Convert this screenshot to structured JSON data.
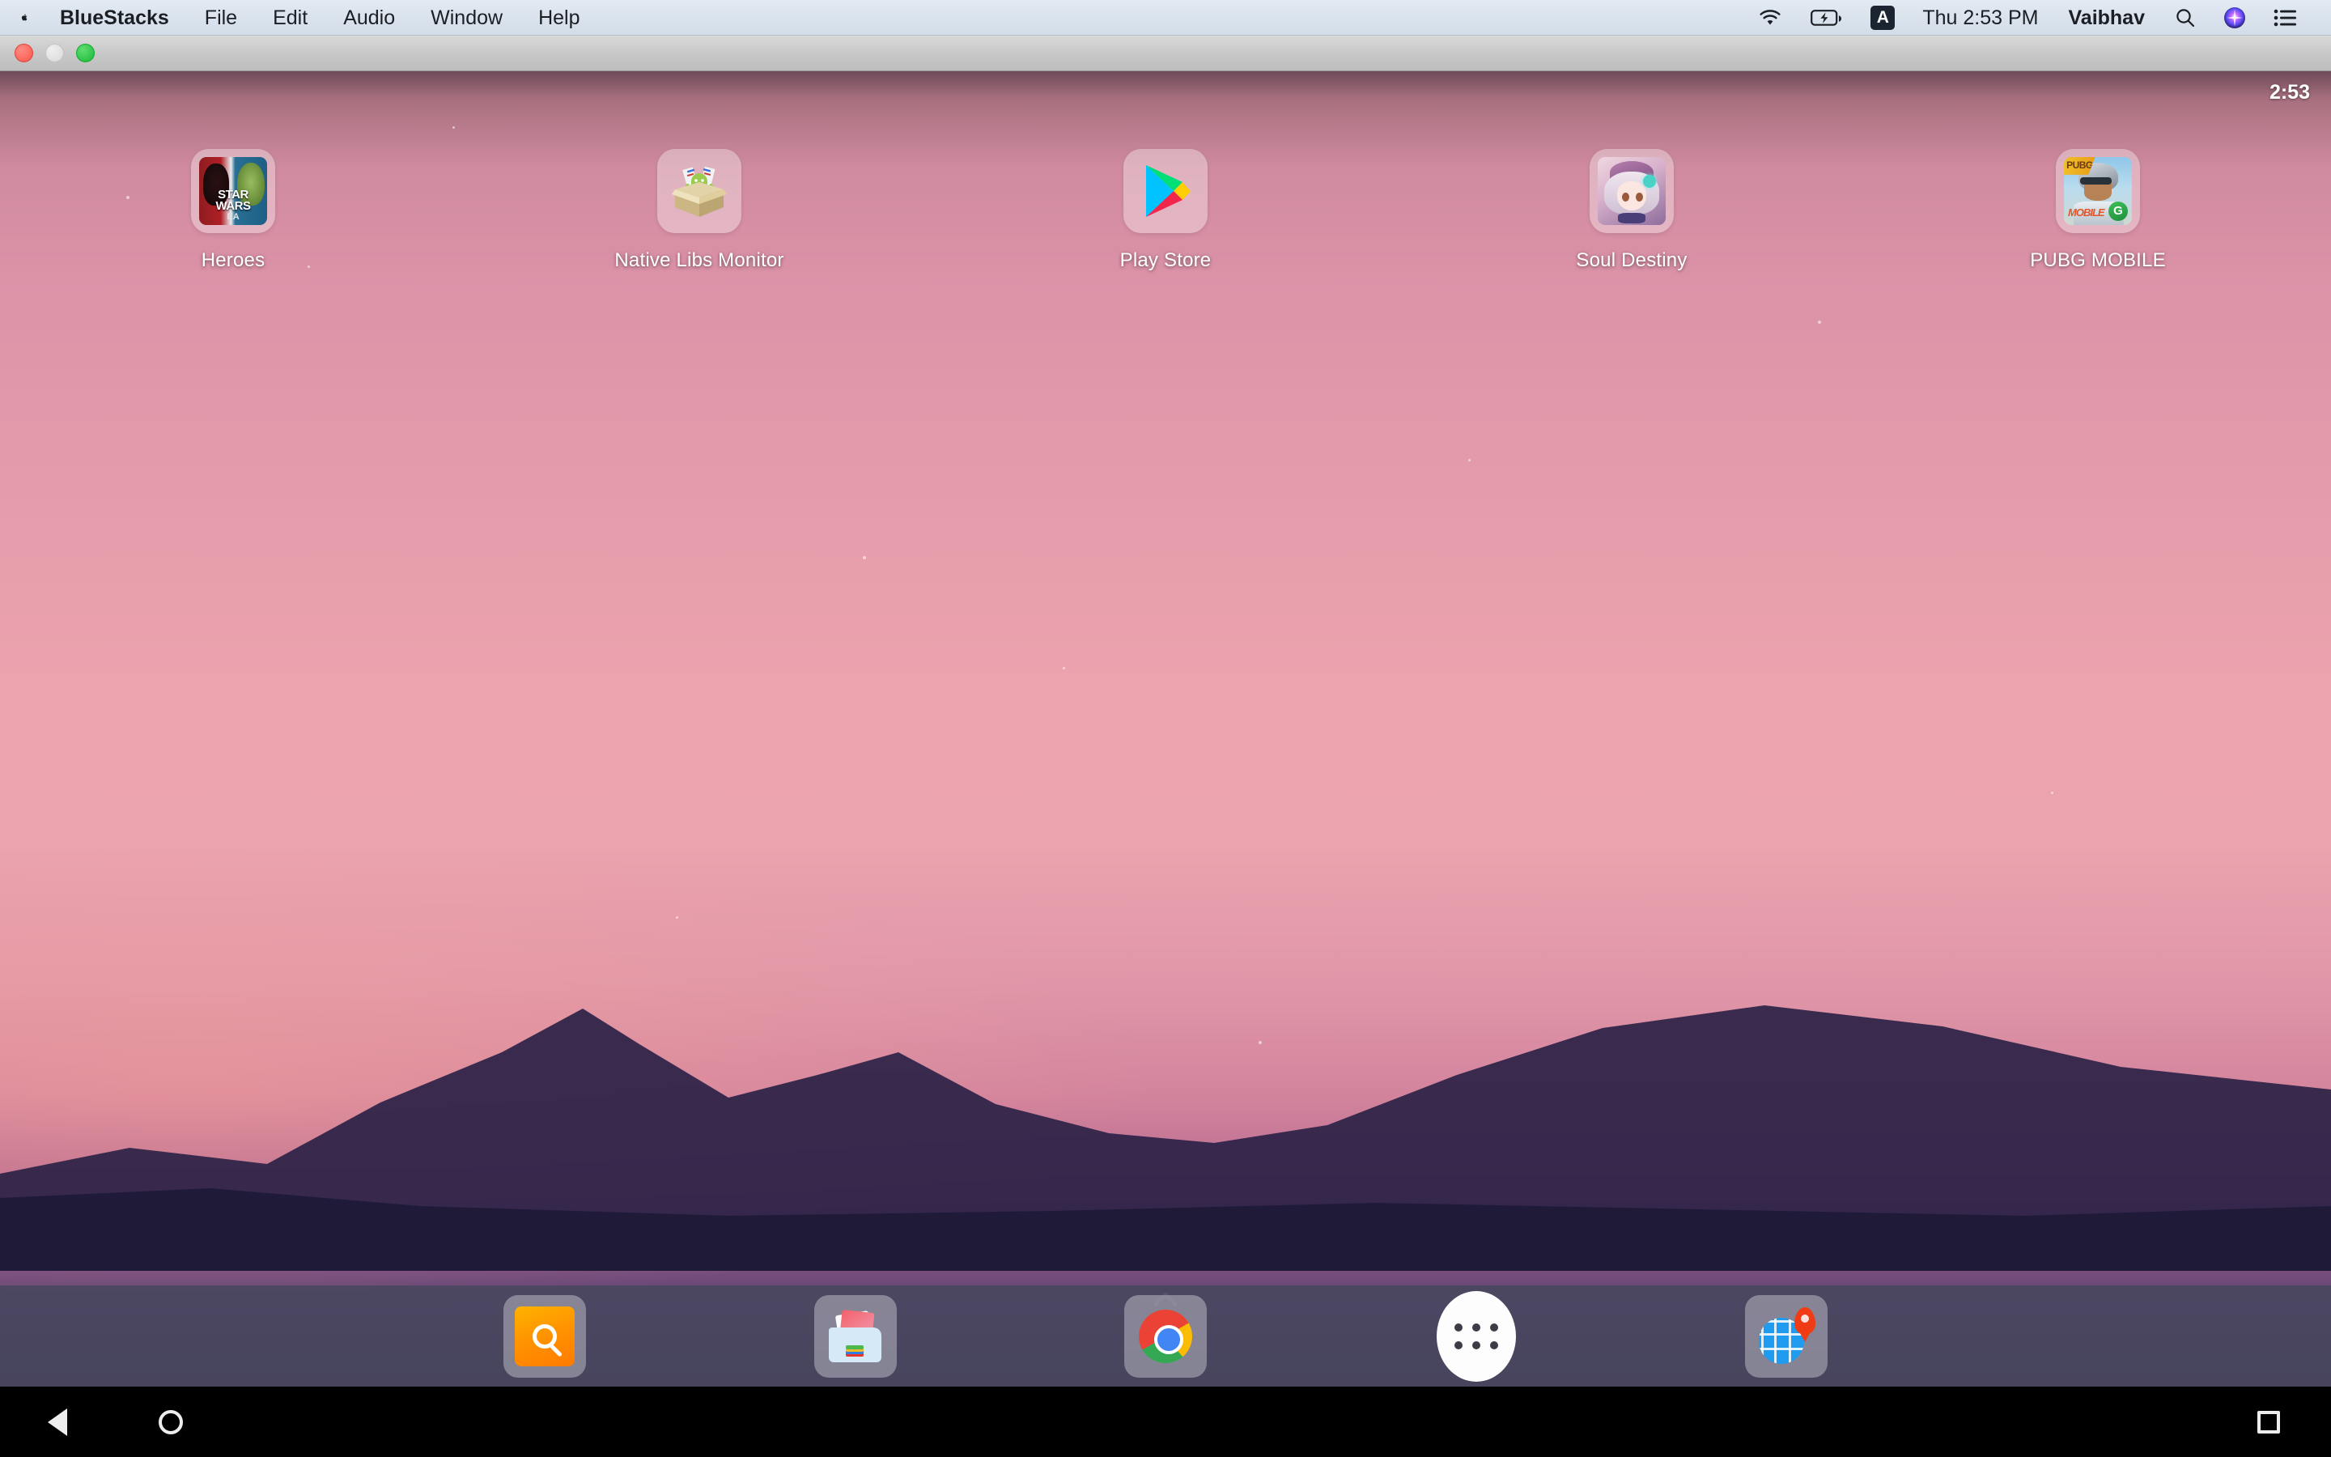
{
  "menubar": {
    "apple_icon": "apple-logo",
    "app_name": "BlueStacks",
    "items": [
      "File",
      "Edit",
      "Audio",
      "Window",
      "Help"
    ],
    "status": {
      "wifi_icon": "wifi-icon",
      "battery_icon": "battery-charging-icon",
      "input_source": "A",
      "datetime": "Thu 2:53 PM",
      "user": "Vaibhav",
      "search_icon": "spotlight-search-icon",
      "siri_icon": "siri-icon",
      "notification_icon": "notification-center-icon"
    }
  },
  "window": {
    "close_label": "close",
    "minimize_label": "minimize",
    "zoom_label": "zoom"
  },
  "android": {
    "status_clock": "2:53",
    "apps": [
      {
        "label": "Heroes",
        "icon": "star-wars-heroes-icon",
        "sw_line1": "STAR",
        "sw_line2": "WARS",
        "publisher": "EA"
      },
      {
        "label": "Native Libs Monitor",
        "icon": "native-libs-monitor-icon"
      },
      {
        "label": "Play Store",
        "icon": "google-play-store-icon"
      },
      {
        "label": "Soul Destiny",
        "icon": "soul-destiny-icon"
      },
      {
        "label": "PUBG MOBILE",
        "icon": "pubg-mobile-icon",
        "flag_text": "PUBG",
        "word_mark": "MOBILE",
        "publisher_mark": "G"
      }
    ],
    "drawer_hint_icon": "chevron-up-icon",
    "dock": [
      {
        "label": "Search",
        "icon": "search-icon"
      },
      {
        "label": "Media Manager",
        "icon": "gallery-folder-icon"
      },
      {
        "label": "Chrome",
        "icon": "chrome-icon"
      },
      {
        "label": "All Apps",
        "icon": "app-drawer-icon"
      },
      {
        "label": "Browser",
        "icon": "globe-location-icon"
      }
    ],
    "navbar": {
      "back": "Back",
      "home": "Home",
      "recents": "Recents"
    }
  },
  "colors": {
    "menubar_bg": "#dce5ee",
    "titlebar_bg": "#c8c8c8",
    "dock_bg": "#4a4760",
    "navbar_bg": "#000000",
    "wallpaper_top": "#d08ba0",
    "wallpaper_mid": "#eca3ae",
    "wallpaper_bottom": "#221f40",
    "accent_orange": "#ff9500",
    "close_red": "#f8574b",
    "zoom_green": "#18ba36"
  }
}
